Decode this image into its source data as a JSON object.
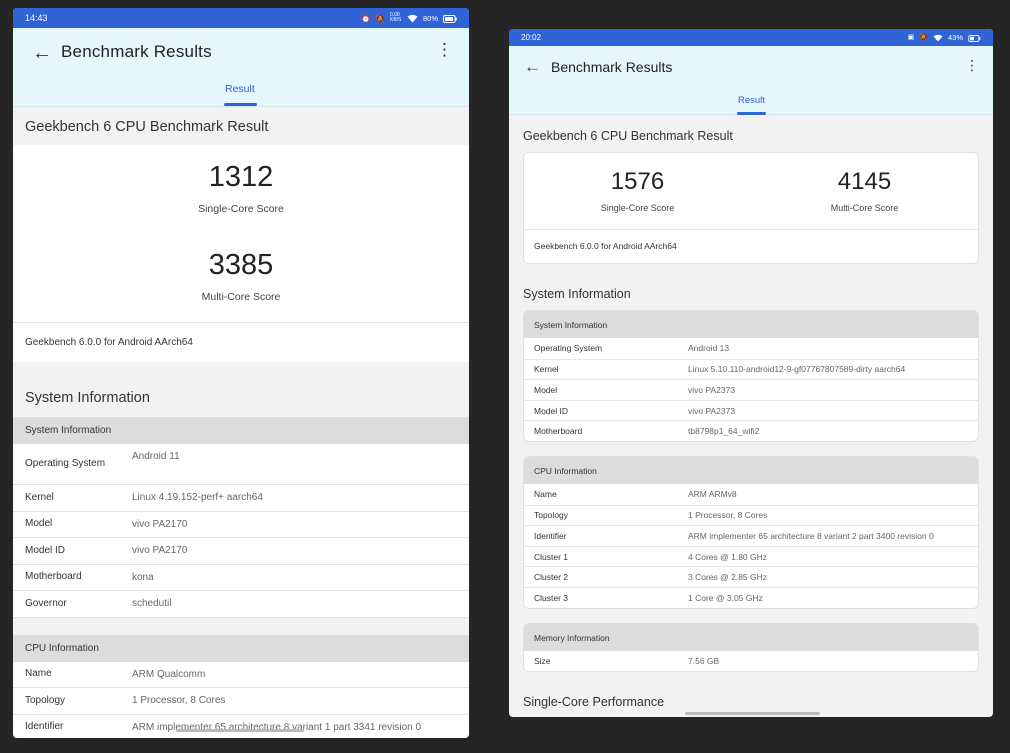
{
  "left": {
    "status": {
      "time": "14:43",
      "net": "0.00 KB/S",
      "battery": "80%"
    },
    "appbar": {
      "title": "Benchmark  Results",
      "tab": "Result"
    },
    "result_title": "Geekbench 6 CPU Benchmark Result",
    "single_score": "1312",
    "single_label": "Single-Core Score",
    "multi_score": "3385",
    "multi_label": "Multi-Core Score",
    "version": "Geekbench 6.0.0 for Android AArch64",
    "sysinfo_title": "System Information",
    "system_group": "System Information",
    "system_rows": [
      {
        "k": "Operating System",
        "v": "Android 11"
      },
      {
        "k": "Kernel",
        "v": "Linux 4.19.152-perf+ aarch64"
      },
      {
        "k": "Model",
        "v": "vivo PA2170"
      },
      {
        "k": "Model ID",
        "v": "vivo PA2170"
      },
      {
        "k": "Motherboard",
        "v": "kona"
      },
      {
        "k": "Governor",
        "v": "schedutil"
      }
    ],
    "cpu_group": "CPU Information",
    "cpu_rows": [
      {
        "k": "Name",
        "v": "ARM Qualcomm"
      },
      {
        "k": "Topology",
        "v": "1 Processor, 8 Cores"
      },
      {
        "k": "Identifier",
        "v": "ARM implementer 65 architecture 8 variant 1 part 3341 revision 0"
      }
    ]
  },
  "right": {
    "status": {
      "time": "20:02",
      "battery": "43%"
    },
    "appbar": {
      "title": "Benchmark Results",
      "tab": "Result"
    },
    "result_title": "Geekbench 6 CPU Benchmark Result",
    "single_score": "1576",
    "single_label": "Single-Core Score",
    "multi_score": "4145",
    "multi_label": "Multi-Core Score",
    "version": "Geekbench 6.0.0 for Android AArch64",
    "sysinfo_title": "System Information",
    "system_group": "System Information",
    "system_rows": [
      {
        "k": "Operating System",
        "v": "Android 13"
      },
      {
        "k": "Kernel",
        "v": "Linux 5.10.110-android12-9-gf07767807589-dirty aarch64"
      },
      {
        "k": "Model",
        "v": "vivo PA2373"
      },
      {
        "k": "Model ID",
        "v": "vivo PA2373"
      },
      {
        "k": "Motherboard",
        "v": "tb8798p1_64_wifi2"
      }
    ],
    "cpu_group": "CPU Information",
    "cpu_rows": [
      {
        "k": "Name",
        "v": "ARM ARMv8"
      },
      {
        "k": "Topology",
        "v": "1 Processor, 8 Cores"
      },
      {
        "k": "Identifier",
        "v": "ARM implementer 65 architecture 8 variant 2 part 3400 revision 0"
      },
      {
        "k": "Cluster 1",
        "v": "4 Cores @ 1.80 GHz"
      },
      {
        "k": "Cluster 2",
        "v": "3 Cores @ 2.85 GHz"
      },
      {
        "k": "Cluster 3",
        "v": "1 Core @ 3.05 GHz"
      }
    ],
    "memory_group": "Memory Information",
    "memory_rows": [
      {
        "k": "Size",
        "v": "7.56 GB"
      }
    ],
    "single_perf_title": "Single-Core Performance"
  },
  "colors": {
    "accent": "#2f63d6",
    "appbar": "#e5f7fb",
    "group_header": "#dcdcdc"
  }
}
